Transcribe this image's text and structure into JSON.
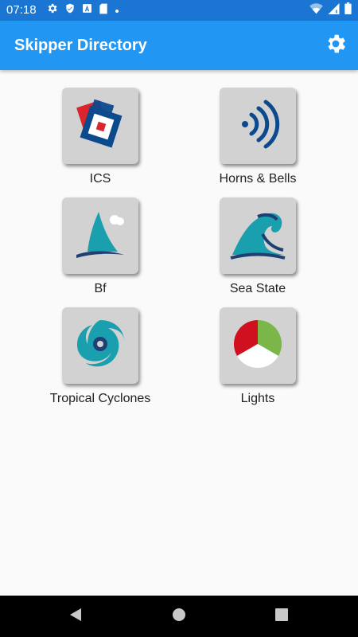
{
  "status_bar": {
    "time": "07:18",
    "left_icons": [
      "gear-icon",
      "shield-icon",
      "a-icon",
      "sd-card-icon",
      "dot-icon"
    ],
    "right_icons": [
      "wifi-icon",
      "signal-icon",
      "battery-icon"
    ]
  },
  "app_bar": {
    "title": "Skipper Directory",
    "settings_icon": "gear-icon",
    "color": "#2196f3"
  },
  "tiles": [
    {
      "label": "ICS",
      "icon": "ics-flag-icon"
    },
    {
      "label": "Horns & Bells",
      "icon": "sound-waves-icon"
    },
    {
      "label": "Bf",
      "icon": "sail-wave-icon"
    },
    {
      "label": "Sea State",
      "icon": "breaking-wave-icon"
    },
    {
      "label": "Tropical Cyclones",
      "icon": "cyclone-icon"
    },
    {
      "label": "Lights",
      "icon": "navigation-lights-icon"
    }
  ],
  "nav_bar": {
    "back": "back-icon",
    "home": "home-icon",
    "recents": "recents-icon"
  }
}
